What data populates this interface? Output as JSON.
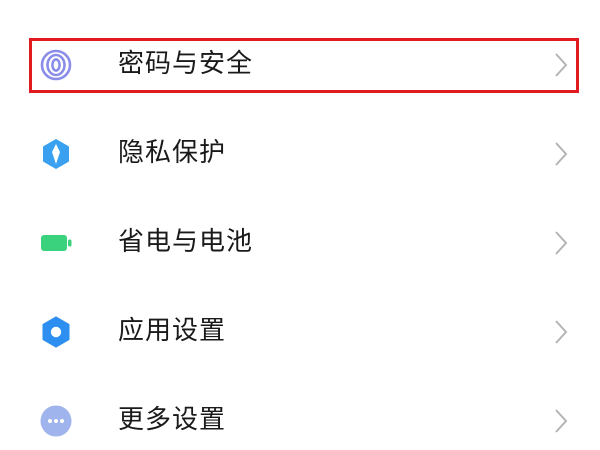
{
  "settings": {
    "items": [
      {
        "label": "密码与安全",
        "icon": "fingerprint-icon",
        "color": "#8b8ee8"
      },
      {
        "label": "隐私保护",
        "icon": "privacy-shield-icon",
        "color": "#3aa0f0"
      },
      {
        "label": "省电与电池",
        "icon": "battery-icon",
        "color": "#3bd27e"
      },
      {
        "label": "应用设置",
        "icon": "gear-icon",
        "color": "#2d8ff0"
      },
      {
        "label": "更多设置",
        "icon": "more-dots-icon",
        "color": "#9fb3ec"
      }
    ],
    "highlight_color": "#e01a1f",
    "chevron_color": "#b4b4b4"
  }
}
